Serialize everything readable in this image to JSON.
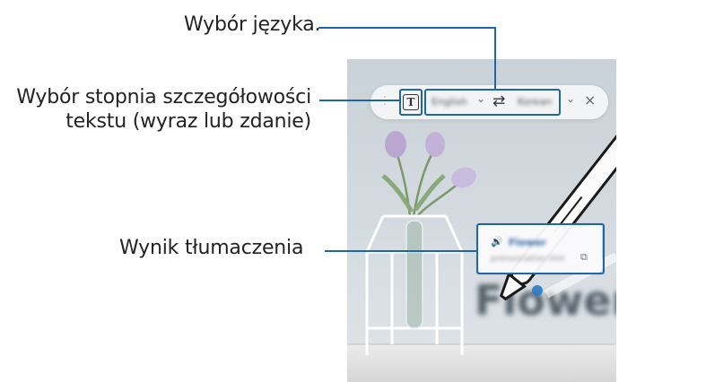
{
  "callouts": {
    "language_selection": "Wybór języka.",
    "granularity_line1": "Wybór stopnia szczegółowości",
    "granularity_line2": "tekstu (wyraz lub zdanie)",
    "translation_result": "Wynik tłumaczenia"
  },
  "translator_toolbar": {
    "mode_icon": "text-mode-icon",
    "mode_glyph": "T",
    "source_language": "English",
    "target_language": "Korean",
    "swap_glyph": "⇄",
    "dropdown_glyph": "⌄",
    "close_glyph": "×"
  },
  "translation_card": {
    "speaker_glyph": "🔊",
    "word": "Flower",
    "pronunciation": "pronunciation hint",
    "copy_glyph": "⧉"
  },
  "photo": {
    "blurred_word": "Flower"
  },
  "colors": {
    "leader_line": "#1e66a8",
    "highlight": "#1e66a8",
    "background": "#ffffff",
    "photo_wall": "#cdd5db"
  }
}
